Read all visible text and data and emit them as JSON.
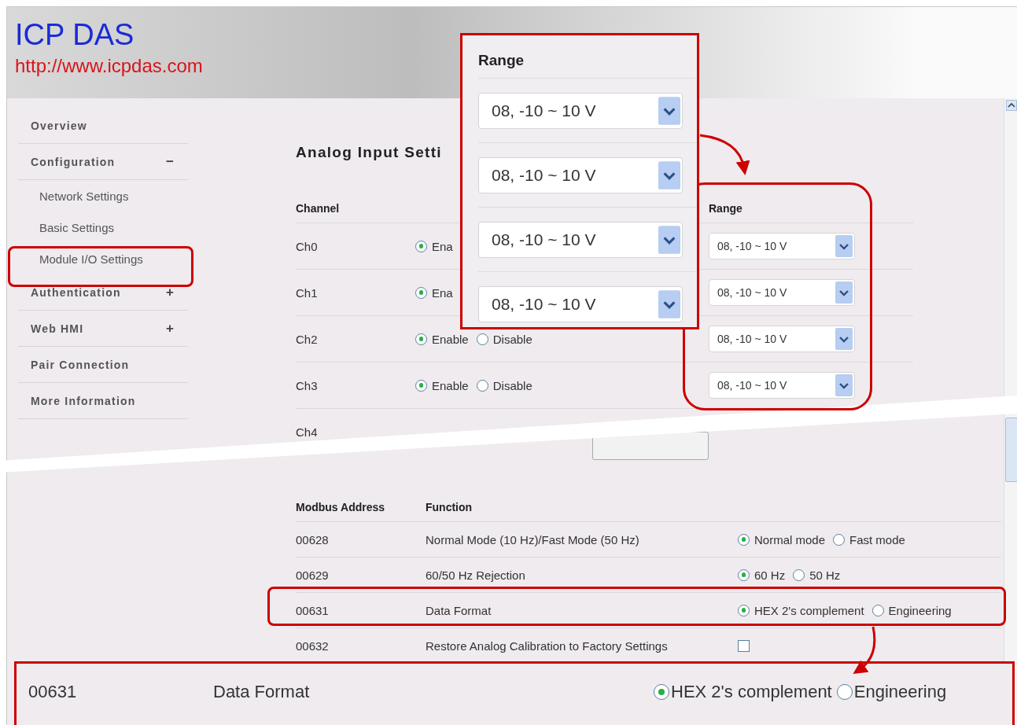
{
  "header": {
    "brand": "ICP DAS",
    "url": "http://www.icpdas.com"
  },
  "sidebar": {
    "items": [
      {
        "label": "Overview"
      },
      {
        "label": "Configuration",
        "toggle": "−",
        "children": [
          {
            "label": "Network Settings"
          },
          {
            "label": "Basic Settings"
          },
          {
            "label": "Module I/O Settings"
          }
        ]
      },
      {
        "label": "Authentication",
        "toggle": "+"
      },
      {
        "label": "Web HMI",
        "toggle": "+"
      },
      {
        "label": "Pair Connection"
      },
      {
        "label": "More Information"
      }
    ]
  },
  "analog_input": {
    "title": "Analog Input Setti",
    "columns": [
      "Channel",
      "Range"
    ],
    "channels": [
      {
        "name": "Ch0",
        "options": [
          {
            "label": "Ena",
            "selected": true
          }
        ],
        "range": "08, -10 ~ 10 V"
      },
      {
        "name": "Ch1",
        "options": [
          {
            "label": "Ena",
            "selected": true
          }
        ],
        "range": "08, -10 ~ 10 V"
      },
      {
        "name": "Ch2",
        "options": [
          {
            "label": "Enable",
            "selected": true
          },
          {
            "label": "Disable",
            "selected": false
          }
        ],
        "range": "08, -10 ~ 10 V"
      },
      {
        "name": "Ch3",
        "options": [
          {
            "label": "Enable",
            "selected": true
          },
          {
            "label": "Disable",
            "selected": false
          }
        ],
        "range": "08, -10 ~ 10 V"
      },
      {
        "name": "Ch4"
      }
    ]
  },
  "range_callout": {
    "title": "Range",
    "values": [
      "08, -10 ~ 10 V",
      "08, -10 ~ 10 V",
      "08, -10 ~ 10 V",
      "08, -10 ~ 10 V"
    ]
  },
  "modbus": {
    "columns": [
      "Modbus Address",
      "Function"
    ],
    "rows": [
      {
        "address": "00628",
        "function": "Normal Mode (10 Hz)/Fast Mode (50 Hz)",
        "kind": "radio",
        "options": [
          {
            "label": "Normal mode",
            "selected": true
          },
          {
            "label": "Fast mode",
            "selected": false
          }
        ]
      },
      {
        "address": "00629",
        "function": "60/50 Hz Rejection",
        "kind": "radio",
        "options": [
          {
            "label": "60 Hz",
            "selected": true
          },
          {
            "label": "50 Hz",
            "selected": false
          }
        ]
      },
      {
        "address": "00631",
        "function": "Data Format",
        "kind": "radio",
        "options": [
          {
            "label": "HEX 2's complement",
            "selected": true
          },
          {
            "label": "Engineering",
            "selected": false
          }
        ]
      },
      {
        "address": "00632",
        "function": "Restore Analog Calibration to Factory Settings",
        "kind": "checkbox",
        "checked": false
      }
    ]
  },
  "format_callout": {
    "address": "00631",
    "function": "Data Format",
    "options": [
      {
        "label": "HEX 2's complement",
        "selected": true
      },
      {
        "label": "Engineering",
        "selected": false
      }
    ]
  }
}
